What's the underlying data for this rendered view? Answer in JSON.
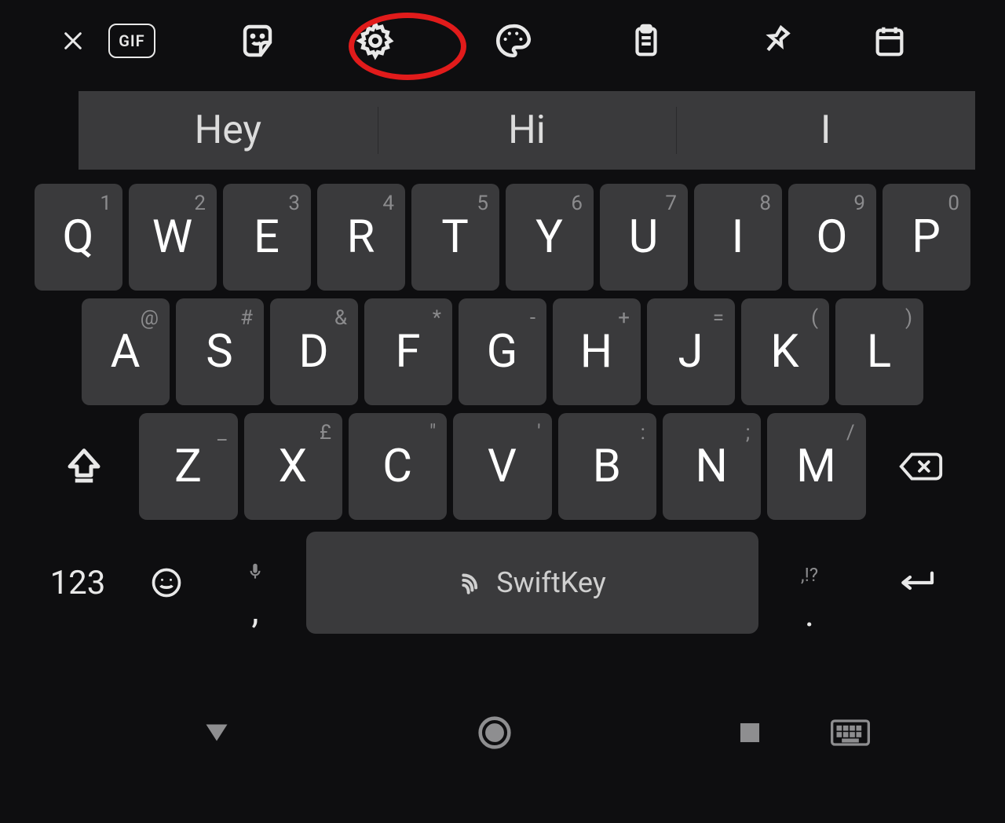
{
  "toolbar": {
    "gif_label": "GIF"
  },
  "suggestions": [
    "Hey",
    "Hi",
    "I"
  ],
  "rows": {
    "r1": [
      {
        "hint": "1",
        "main": "Q"
      },
      {
        "hint": "2",
        "main": "W"
      },
      {
        "hint": "3",
        "main": "E"
      },
      {
        "hint": "4",
        "main": "R"
      },
      {
        "hint": "5",
        "main": "T"
      },
      {
        "hint": "6",
        "main": "Y"
      },
      {
        "hint": "7",
        "main": "U"
      },
      {
        "hint": "8",
        "main": "I"
      },
      {
        "hint": "9",
        "main": "O"
      },
      {
        "hint": "0",
        "main": "P"
      }
    ],
    "r2": [
      {
        "hint": "@",
        "main": "A"
      },
      {
        "hint": "#",
        "main": "S"
      },
      {
        "hint": "&",
        "main": "D"
      },
      {
        "hint": "*",
        "main": "F"
      },
      {
        "hint": "-",
        "main": "G"
      },
      {
        "hint": "+",
        "main": "H"
      },
      {
        "hint": "=",
        "main": "J"
      },
      {
        "hint": "(",
        "main": "K"
      },
      {
        "hint": ")",
        "main": "L"
      }
    ],
    "r3": [
      {
        "hint": "_",
        "main": "Z"
      },
      {
        "hint": "£",
        "main": "X"
      },
      {
        "hint": "\"",
        "main": "C"
      },
      {
        "hint": "'",
        "main": "V"
      },
      {
        "hint": ":",
        "main": "B"
      },
      {
        "hint": ";",
        "main": "N"
      },
      {
        "hint": "/",
        "main": "M"
      }
    ]
  },
  "bottom": {
    "numeric_label": "123",
    "spacebar_label": "SwiftKey",
    "period_hint": ",!?",
    "comma": ",",
    "period": "."
  }
}
